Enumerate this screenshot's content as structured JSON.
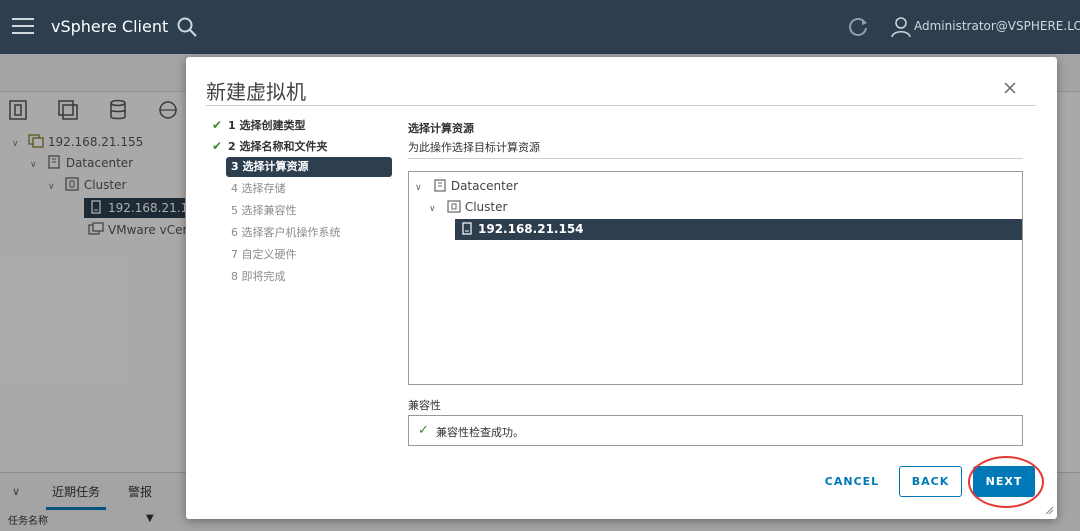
{
  "header": {
    "app_title": "vSphere Client",
    "user": "Administrator@VSPHERE.LOCAL"
  },
  "sidebar": {
    "tree": [
      {
        "label": "192.168.21.155",
        "icon": "vcenter-icon"
      },
      {
        "label": "Datacenter",
        "icon": "datacenter-icon"
      },
      {
        "label": "Cluster",
        "icon": "cluster-icon"
      },
      {
        "label": "192.168.21.154",
        "icon": "host-icon"
      },
      {
        "label": "VMware vCen",
        "icon": "vm-icon"
      }
    ]
  },
  "bottom": {
    "tabs": [
      "近期任务",
      "警报"
    ],
    "column_task_name": "任务名称"
  },
  "wizard": {
    "title": "新建虚拟机",
    "steps": [
      {
        "label": "1 选择创建类型",
        "state": "done"
      },
      {
        "label": "2 选择名称和文件夹",
        "state": "done"
      },
      {
        "label": "3 选择计算资源",
        "state": "active"
      },
      {
        "label": "4 选择存储",
        "state": "pending"
      },
      {
        "label": "5 选择兼容性",
        "state": "pending"
      },
      {
        "label": "6 选择客户机操作系统",
        "state": "pending"
      },
      {
        "label": "7 自定义硬件",
        "state": "pending"
      },
      {
        "label": "8 即将完成",
        "state": "pending"
      }
    ],
    "heading": "选择计算资源",
    "subheading": "为此操作选择目标计算资源",
    "resource_tree": [
      {
        "label": "Datacenter",
        "icon": "datacenter-icon"
      },
      {
        "label": "Cluster",
        "icon": "cluster-icon"
      },
      {
        "label": "192.168.21.154",
        "icon": "host-icon",
        "selected": true
      }
    ],
    "compat_label": "兼容性",
    "compat_message": "兼容性检查成功。",
    "buttons": {
      "cancel": "CANCEL",
      "back": "BACK",
      "next": "NEXT"
    }
  },
  "colors": {
    "header_bg": "#2d3e4f",
    "accent": "#0079b8",
    "success": "#3c8d2a",
    "annotation": "#e53935"
  }
}
